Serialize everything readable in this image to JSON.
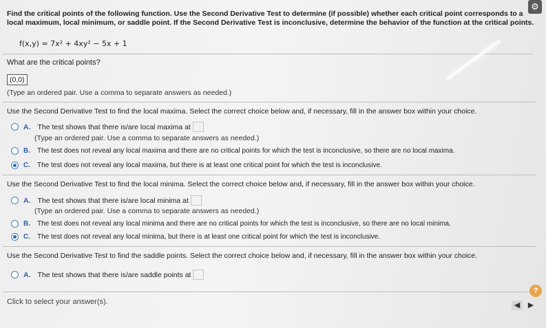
{
  "header": {
    "question": "Find the critical points of the following function. Use the Second Derivative Test to determine (if possible) whether each critical point corresponds to a local maximum, local minimum, or saddle point. If the Second Derivative Test is inconclusive, determine the behavior of the function at the critical points.",
    "function": "f(x,y) = 7x² + 4xy² − 5x + 1"
  },
  "critical": {
    "prompt": "What are the critical points?",
    "answer": "(0,0)",
    "hint": "(Type an ordered pair. Use a comma to separate answers as needed.)"
  },
  "maxima": {
    "prompt": "Use the Second Derivative Test to find the local maxima. Select the correct choice below and, if necessary, fill in the answer box within your choice.",
    "a": "The test shows that there is/are local maxima at",
    "a_hint": "(Type an ordered pair. Use a comma to separate answers as needed.)",
    "b": "The test does not reveal any local maxima and there are no critical points for which the test is inconclusive, so there are no local maxima.",
    "c": "The test does not reveal any local maxima, but there is at least one critical point for which the test is inconclusive."
  },
  "minima": {
    "prompt": "Use the Second Derivative Test to find the local minima. Select the correct choice below and, if necessary, fill in the answer box within your choice.",
    "a": "The test shows that there is/are local minima at",
    "a_hint": "(Type an ordered pair. Use a comma to separate answers as needed.)",
    "b": "The test does not reveal any local minima and there are no critical points for which the test is inconclusive, so there are no local minima.",
    "c": "The test does not reveal any local minima, but there is at least one critical point for which the test is inconclusive."
  },
  "saddle": {
    "prompt": "Use the Second Derivative Test to find the saddle points. Select the correct choice below and, if necessary, fill in the answer box within your choice.",
    "a": "The test shows that there is/are saddle points at"
  },
  "letters": {
    "a": "A.",
    "b": "B.",
    "c": "C."
  },
  "footer": {
    "text": "Click to select your answer(s).",
    "help": "?"
  },
  "icons": {
    "settings": "gear-icon",
    "help": "help-icon",
    "prev": "prev-arrow-icon",
    "next": "next-arrow-icon"
  },
  "colors": {
    "accent": "#2d5ea8",
    "help": "#e8a64b"
  }
}
